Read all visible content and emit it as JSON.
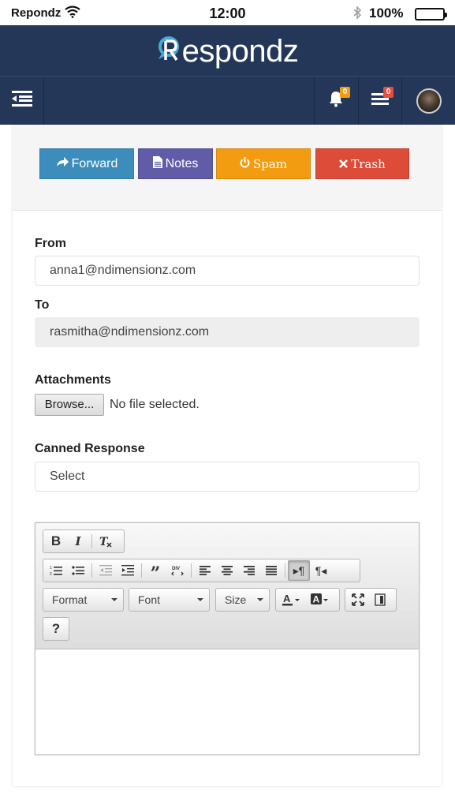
{
  "status_bar": {
    "carrier": "Repondz",
    "time": "12:00",
    "battery": "100%"
  },
  "brand": {
    "logo_text": "espondz",
    "logo_initial": "R"
  },
  "nav": {
    "notifications_count": "0",
    "tasks_count": "0"
  },
  "actions": {
    "forward": "Forward",
    "notes": "Notes",
    "spam": "Spam",
    "trash": "Trash"
  },
  "form": {
    "from_label": "From",
    "from_value": "anna1@ndimensionz.com",
    "to_label": "To",
    "to_value": "rasmitha@ndimensionz.com",
    "attachments_label": "Attachments",
    "browse_label": "Browse...",
    "file_status": "No file selected.",
    "canned_label": "Canned Response",
    "canned_value": "Select"
  },
  "editor": {
    "format_label": "Format",
    "font_label": "Font",
    "size_label": "Size",
    "help_label": "?"
  },
  "colors": {
    "navbar": "#253759",
    "forward": "#3c8dbc",
    "notes": "#605ca8",
    "spam": "#f39c12",
    "trash": "#dd4b39"
  }
}
